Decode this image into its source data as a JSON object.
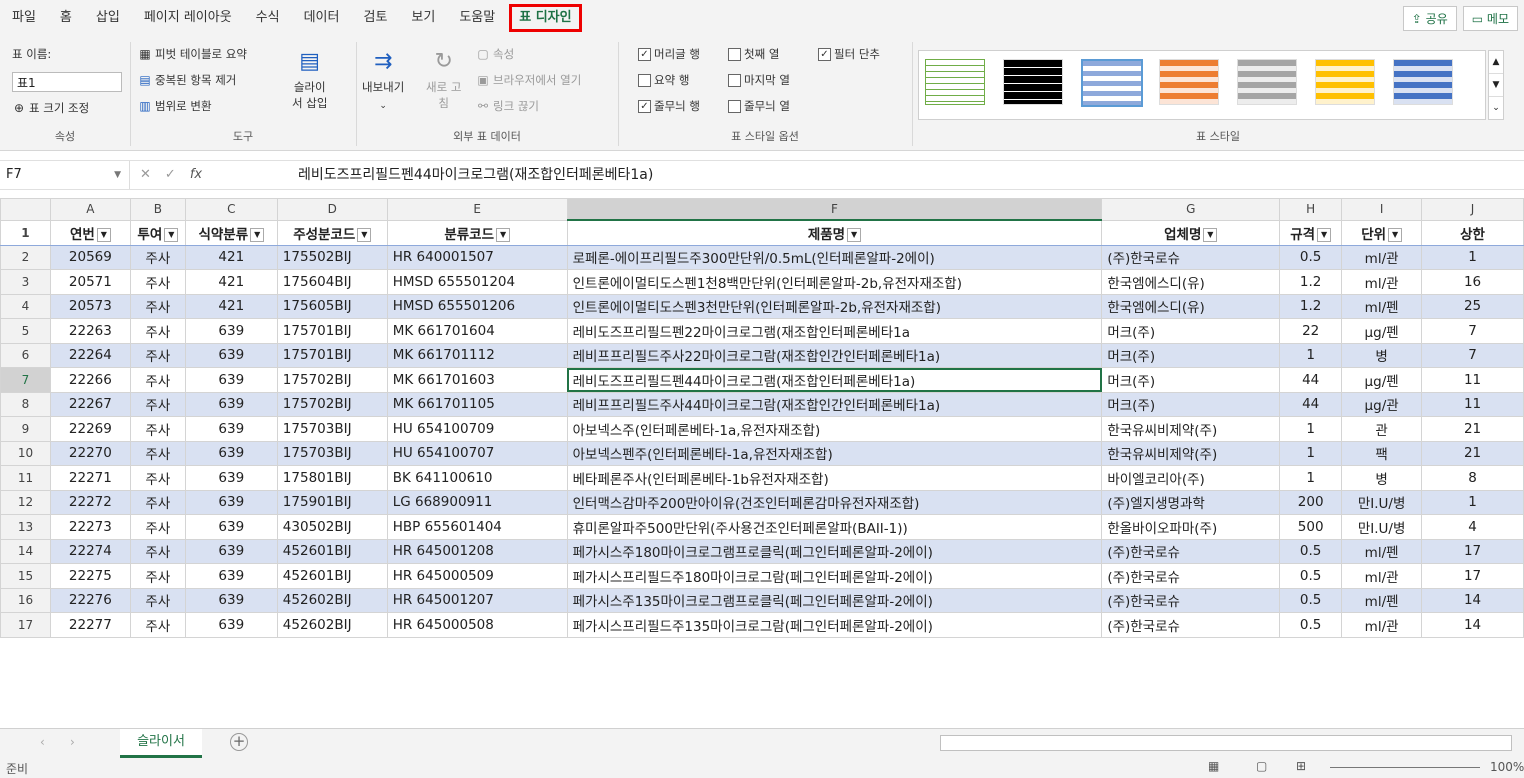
{
  "menu": {
    "tabs": [
      "파일",
      "홈",
      "삽입",
      "페이지 레이아웃",
      "수식",
      "데이터",
      "검토",
      "보기",
      "도움말",
      "표 디자인"
    ],
    "share": "공유",
    "memo": "메모"
  },
  "ribbon": {
    "props": {
      "name_label": "표 이름:",
      "name_value": "표1",
      "resize": "표 크기 조정",
      "group": "속성"
    },
    "tools": {
      "pivot": "피벗 테이블로 요약",
      "dedupe": "중복된 항목 제거",
      "convert": "범위로 변환",
      "slicer": "슬라이\n서 삽입",
      "group": "도구"
    },
    "external": {
      "export": "내보내기",
      "refresh": "새로 고\n침",
      "props": "속성",
      "browser": "브라우저에서 열기",
      "unlink": "링크 끊기",
      "group": "외부 표 데이터"
    },
    "options": {
      "header_row": "머리글 행",
      "first_col": "첫째 열",
      "filter": "필터 단추",
      "total_row": "요약 행",
      "last_col": "마지막 열",
      "banded_rows": "줄무늬 행",
      "banded_cols": "줄무늬 열",
      "group": "표 스타일 옵션"
    },
    "styles": {
      "group": "표 스타일"
    }
  },
  "formula": {
    "cell_ref": "F7",
    "fx": "fx",
    "value": "레비도즈프리필드펜44마이크로그램(재조합인터페론베타1a)"
  },
  "columns": [
    "A",
    "B",
    "C",
    "D",
    "E",
    "F",
    "G",
    "H",
    "I",
    "J"
  ],
  "header_row": [
    "연번",
    "투여",
    "식약분류",
    "주성분코드",
    "분류코드",
    "제품명",
    "업체명",
    "규격",
    "단위",
    "상한"
  ],
  "rows": [
    [
      "2",
      "20569",
      "주사",
      "421",
      "175502BIJ",
      "HR 640001507",
      "로페론-에이프리필드주300만단위/0.5mL(인터페론알파-2에이)",
      "(주)한국로슈",
      "0.5",
      "ml/관",
      "1"
    ],
    [
      "3",
      "20571",
      "주사",
      "421",
      "175604BIJ",
      "HMSD 655501204",
      "인트론에이멀티도스펜1천8백만단위(인터페론알파-2b,유전자재조합)",
      "한국엠에스디(유)",
      "1.2",
      "ml/관",
      "16"
    ],
    [
      "4",
      "20573",
      "주사",
      "421",
      "175605BIJ",
      "HMSD 655501206",
      "인트론에이멀티도스펜3천만단위(인터페론알파-2b,유전자재조합)",
      "한국엠에스디(유)",
      "1.2",
      "ml/펜",
      "25"
    ],
    [
      "5",
      "22263",
      "주사",
      "639",
      "175701BIJ",
      "MK 661701604",
      "레비도즈프리필드펜22마이크로그램(재조합인터페론베타1a",
      "머크(주)",
      "22",
      "μg/펜",
      "7"
    ],
    [
      "6",
      "22264",
      "주사",
      "639",
      "175701BIJ",
      "MK 661701112",
      "레비프프리필드주사22마이크로그람(재조합인간인터페론베타1a)",
      "머크(주)",
      "1",
      "병",
      "7"
    ],
    [
      "7",
      "22266",
      "주사",
      "639",
      "175702BIJ",
      "MK 661701603",
      "레비도즈프리필드펜44마이크로그램(재조합인터페론베타1a)",
      "머크(주)",
      "44",
      "μg/펜",
      "11"
    ],
    [
      "8",
      "22267",
      "주사",
      "639",
      "175702BIJ",
      "MK 661701105",
      "레비프프리필드주사44마이크로그람(재조합인간인터페론베타1a)",
      "머크(주)",
      "44",
      "μg/관",
      "11"
    ],
    [
      "9",
      "22269",
      "주사",
      "639",
      "175703BIJ",
      "HU 654100709",
      "아보넥스주(인터페론베타-1a,유전자재조합)",
      "한국유씨비제약(주)",
      "1",
      "관",
      "21"
    ],
    [
      "10",
      "22270",
      "주사",
      "639",
      "175703BIJ",
      "HU 654100707",
      "아보넥스펜주(인터페론베타-1a,유전자재조합)",
      "한국유씨비제약(주)",
      "1",
      "팩",
      "21"
    ],
    [
      "11",
      "22271",
      "주사",
      "639",
      "175801BIJ",
      "BK 641100610",
      "베타페론주사(인터페론베타-1b유전자재조합)",
      "바이엘코리아(주)",
      "1",
      "병",
      "8"
    ],
    [
      "12",
      "22272",
      "주사",
      "639",
      "175901BIJ",
      "LG 668900911",
      "인터맥스감마주200만아이유(건조인터페론감마유전자재조합)",
      "(주)엘지생명과학",
      "200",
      "만I.U/병",
      "1"
    ],
    [
      "13",
      "22273",
      "주사",
      "639",
      "430502BIJ",
      "HBP 655601404",
      "휴미론알파주500만단위(주사용건조인터페론알파(BAII-1))",
      "한올바이오파마(주)",
      "500",
      "만I.U/병",
      "4"
    ],
    [
      "14",
      "22274",
      "주사",
      "639",
      "452601BIJ",
      "HR 645001208",
      "페가시스주180마이크로그램프로클릭(페그인터페론알파-2에이)",
      "(주)한국로슈",
      "0.5",
      "ml/펜",
      "17"
    ],
    [
      "15",
      "22275",
      "주사",
      "639",
      "452601BIJ",
      "HR 645000509",
      "페가시스프리필드주180마이크로그람(페그인터페론알파-2에이)",
      "(주)한국로슈",
      "0.5",
      "ml/관",
      "17"
    ],
    [
      "16",
      "22276",
      "주사",
      "639",
      "452602BIJ",
      "HR 645001207",
      "페가시스주135마이크로그램프로클릭(페그인터페론알파-2에이)",
      "(주)한국로슈",
      "0.5",
      "ml/펜",
      "14"
    ],
    [
      "17",
      "22277",
      "주사",
      "639",
      "452602BIJ",
      "HR 645000508",
      "페가시스프리필드주135마이크로그람(페그인터페론알파-2에이)",
      "(주)한국로슈",
      "0.5",
      "ml/관",
      "14"
    ]
  ],
  "sheet": {
    "tab": "슬라이서",
    "add": "+"
  },
  "status": {
    "left": "준비",
    "zoom": "100%"
  },
  "colors": {
    "accent": "#217346",
    "band": "#d9e1f2",
    "highlight": "#ff0000"
  }
}
